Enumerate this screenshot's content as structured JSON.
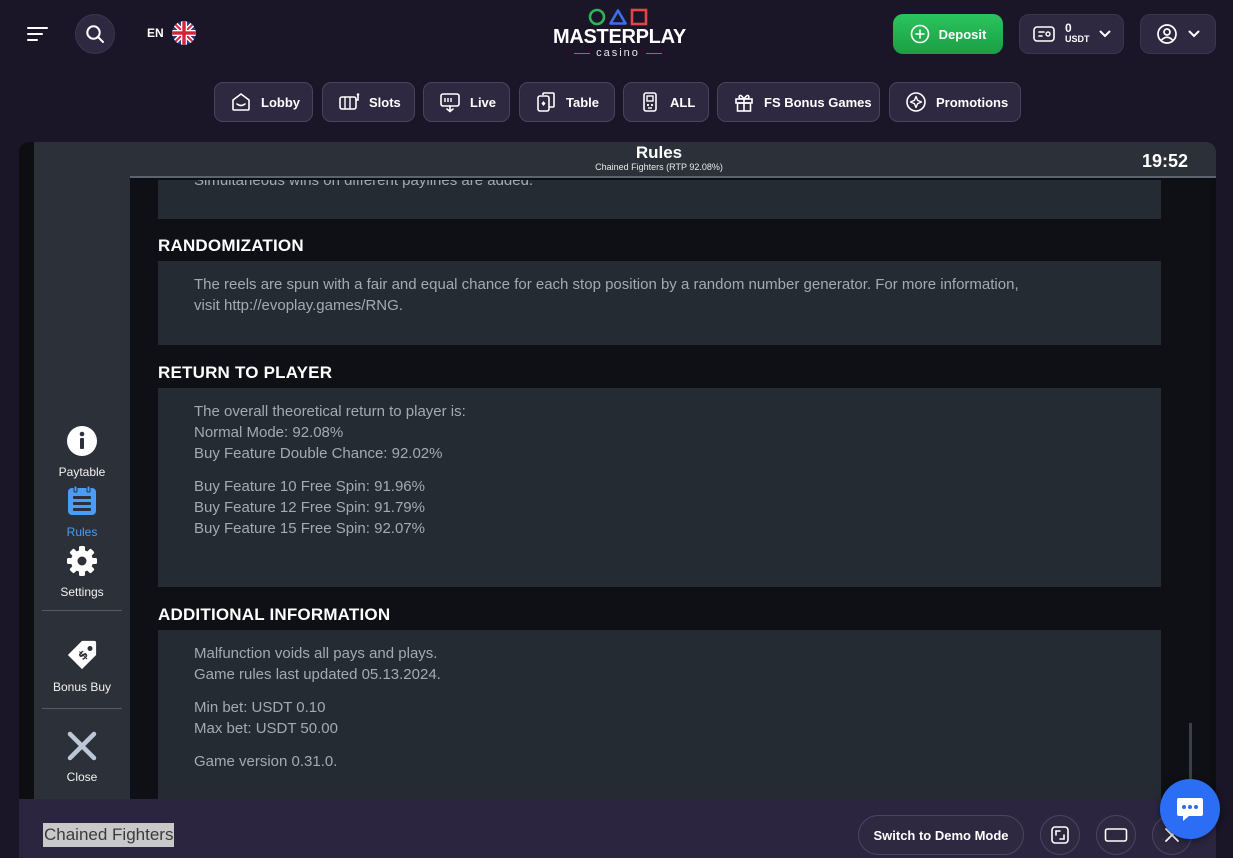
{
  "header": {
    "language": "EN",
    "logo": {
      "word": "MASTERPLAY",
      "sub": "casino"
    },
    "deposit_label": "Deposit",
    "balance": {
      "amount": "0",
      "currency": "USDT"
    }
  },
  "nav": {
    "items": [
      {
        "label": "Lobby",
        "icon": "lobby-icon"
      },
      {
        "label": "Slots",
        "icon": "slots-icon"
      },
      {
        "label": "Live",
        "icon": "live-icon"
      },
      {
        "label": "Table",
        "icon": "table-icon"
      },
      {
        "label": "ALL",
        "icon": "all-games-icon"
      },
      {
        "label": "FS Bonus Games",
        "icon": "gift-icon"
      },
      {
        "label": "Promotions",
        "icon": "promotions-icon"
      }
    ]
  },
  "game": {
    "sidebar": {
      "paytable": "Paytable",
      "rules": "Rules",
      "settings": "Settings",
      "bonus_buy": "Bonus Buy",
      "close": "Close"
    },
    "rules_header": {
      "title": "Rules",
      "subtitle": "Chained Fighters (RTP 92.08%)",
      "clock": "19:52"
    },
    "content": {
      "cut_line": "Simultaneous wins on different paylines are added.",
      "randomization": {
        "heading": "RANDOMIZATION",
        "line1": "The reels are spun with a fair and equal chance for each stop position by a random number generator. For more information,",
        "line2": "visit http://evoplay.games/RNG."
      },
      "rtp": {
        "heading": "RETURN TO PLAYER",
        "lines_a": [
          "The overall theoretical return to player is:",
          "Normal Mode: 92.08%",
          "Buy Feature Double Chance: 92.02%"
        ],
        "lines_b": [
          "Buy Feature 10 Free Spin: 91.96%",
          "Buy Feature 12 Free Spin: 91.79%",
          "Buy Feature 15 Free Spin: 92.07%"
        ]
      },
      "additional": {
        "heading": "ADDITIONAL INFORMATION",
        "lines_a": [
          "Malfunction voids all pays and plays.",
          "Game rules last updated 05.13.2024."
        ],
        "lines_b": [
          "Min bet: USDT 0.10",
          "Max bet: USDT 50.00"
        ],
        "version": "Game version 0.31.0."
      }
    }
  },
  "bottom_bar": {
    "game_name": "Chained Fighters",
    "demo_label": "Switch to Demo Mode"
  },
  "colors": {
    "page_bg": "#1a1527",
    "deposit": "#22b04f",
    "active_tab": "#4a9cf5",
    "chat": "#2b6df5"
  }
}
